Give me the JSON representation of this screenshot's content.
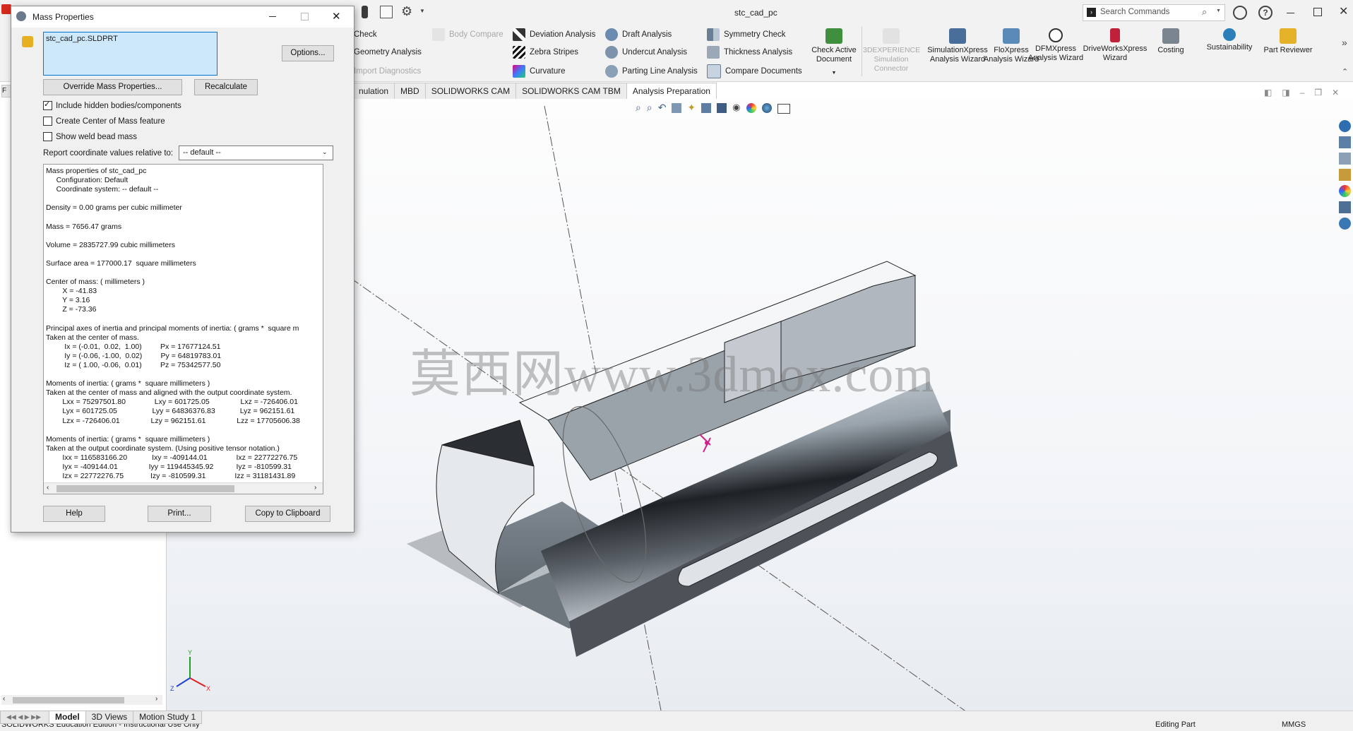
{
  "window": {
    "title": "stc_cad_pc",
    "search_placeholder": "Search Commands"
  },
  "command_manager": {
    "small": [
      {
        "label": "Check",
        "disabled": false
      },
      {
        "label": "Geometry Analysis",
        "disabled": false
      },
      {
        "label": "Import Diagnostics",
        "disabled": true
      },
      {
        "label": "Body Compare",
        "disabled": true
      },
      {
        "label": "Deviation Analysis",
        "disabled": false
      },
      {
        "label": "Zebra Stripes",
        "disabled": false
      },
      {
        "label": "Curvature",
        "disabled": false
      },
      {
        "label": "Draft Analysis",
        "disabled": false
      },
      {
        "label": "Undercut Analysis",
        "disabled": false
      },
      {
        "label": "Parting Line Analysis",
        "disabled": false
      },
      {
        "label": "Symmetry Check",
        "disabled": false
      },
      {
        "label": "Thickness Analysis",
        "disabled": false
      },
      {
        "label": "Compare Documents",
        "disabled": false
      }
    ],
    "big": [
      {
        "label": "Check Active Document",
        "disabled": false
      },
      {
        "label": "3DEXPERIENCE Simulation Connector",
        "disabled": true
      },
      {
        "label": "SimulationXpress Analysis Wizard",
        "disabled": false
      },
      {
        "label": "FloXpress Analysis Wizard",
        "disabled": false
      },
      {
        "label": "DFMXpress Analysis Wizard",
        "disabled": false
      },
      {
        "label": "DriveWorksXpress Wizard",
        "disabled": false
      },
      {
        "label": "Costing",
        "disabled": false
      },
      {
        "label": "Sustainability",
        "disabled": false
      },
      {
        "label": "Part Reviewer",
        "disabled": false
      }
    ]
  },
  "tabs": [
    "nulation",
    "MBD",
    "SOLIDWORKS CAM",
    "SOLIDWORKS CAM TBM",
    "Analysis Preparation"
  ],
  "bottom_tabs": [
    "Model",
    "3D Views",
    "Motion Study 1"
  ],
  "status": {
    "left": "SOLIDWORKS Education Edition - Instructional Use Only",
    "mid": "Editing Part",
    "units": "MMGS"
  },
  "dialog": {
    "title": "Mass Properties",
    "selection": "stc_cad_pc.SLDPRT",
    "options_btn": "Options...",
    "override_btn": "Override Mass Properties...",
    "recalc_btn": "Recalculate",
    "chk_hidden": "Include hidden bodies/components",
    "chk_com": "Create Center of Mass feature",
    "chk_weld": "Show weld bead mass",
    "coord_label": "Report coordinate values relative to:",
    "coord_value": "-- default --",
    "help_btn": "Help",
    "print_btn": "Print...",
    "copy_btn": "Copy to Clipboard",
    "results": "Mass properties of stc_cad_pc\n     Configuration: Default\n     Coordinate system: -- default --\n\nDensity = 0.00 grams per cubic millimeter\n\nMass = 7656.47 grams\n\nVolume = 2835727.99 cubic millimeters\n\nSurface area = 177000.17  square millimeters\n\nCenter of mass: ( millimeters )\n        X = -41.83\n        Y = 3.16\n        Z = -73.36\n\nPrincipal axes of inertia and principal moments of inertia: ( grams *  square m\nTaken at the center of mass.\n         Ix = (-0.01,  0.02,  1.00)         Px = 17677124.51\n         Iy = (-0.06, -1.00,  0.02)         Py = 64819783.01\n         Iz = ( 1.00, -0.06,  0.01)         Pz = 75342577.50\n\nMoments of inertia: ( grams *  square millimeters )\nTaken at the center of mass and aligned with the output coordinate system.\n        Lxx = 75297501.80              Lxy = 601725.05               Lxz = -726406.01\n        Lyx = 601725.05                 Lyy = 64836376.83            Lyz = 962151.61\n        Lzx = -726406.01               Lzy = 962151.61               Lzz = 17705606.38\n\nMoments of inertia: ( grams *  square millimeters )\nTaken at the output coordinate system. (Using positive tensor notation.)\n        Ixx = 116583166.20            Ixy = -409144.01              Ixz = 22772276.75\n        Iyx = -409144.01               Iyy = 119445345.92           Iyz = -810599.31\n        Izx = 22772276.75             Izy = -810599.31              Izz = 31181431.89"
  },
  "watermark": "莫西网www.3dmox.com",
  "colors": {
    "selection_bg": "#cde8fa",
    "accent": "#0078d7",
    "triad_x": "#e02020",
    "triad_y": "#20a020",
    "triad_z": "#2040d0"
  }
}
